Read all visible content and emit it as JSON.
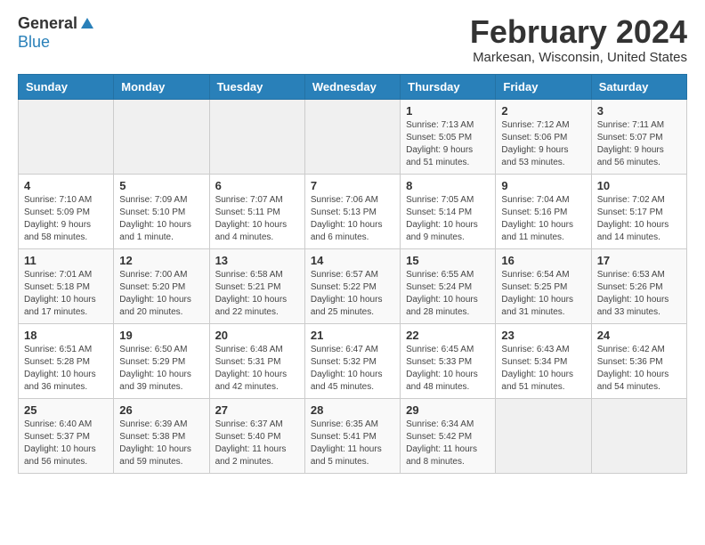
{
  "header": {
    "logo_general": "General",
    "logo_blue": "Blue",
    "month_title": "February 2024",
    "location": "Markesan, Wisconsin, United States"
  },
  "weekdays": [
    "Sunday",
    "Monday",
    "Tuesday",
    "Wednesday",
    "Thursday",
    "Friday",
    "Saturday"
  ],
  "weeks": [
    [
      {
        "day": "",
        "info": ""
      },
      {
        "day": "",
        "info": ""
      },
      {
        "day": "",
        "info": ""
      },
      {
        "day": "",
        "info": ""
      },
      {
        "day": "1",
        "info": "Sunrise: 7:13 AM\nSunset: 5:05 PM\nDaylight: 9 hours\nand 51 minutes."
      },
      {
        "day": "2",
        "info": "Sunrise: 7:12 AM\nSunset: 5:06 PM\nDaylight: 9 hours\nand 53 minutes."
      },
      {
        "day": "3",
        "info": "Sunrise: 7:11 AM\nSunset: 5:07 PM\nDaylight: 9 hours\nand 56 minutes."
      }
    ],
    [
      {
        "day": "4",
        "info": "Sunrise: 7:10 AM\nSunset: 5:09 PM\nDaylight: 9 hours\nand 58 minutes."
      },
      {
        "day": "5",
        "info": "Sunrise: 7:09 AM\nSunset: 5:10 PM\nDaylight: 10 hours\nand 1 minute."
      },
      {
        "day": "6",
        "info": "Sunrise: 7:07 AM\nSunset: 5:11 PM\nDaylight: 10 hours\nand 4 minutes."
      },
      {
        "day": "7",
        "info": "Sunrise: 7:06 AM\nSunset: 5:13 PM\nDaylight: 10 hours\nand 6 minutes."
      },
      {
        "day": "8",
        "info": "Sunrise: 7:05 AM\nSunset: 5:14 PM\nDaylight: 10 hours\nand 9 minutes."
      },
      {
        "day": "9",
        "info": "Sunrise: 7:04 AM\nSunset: 5:16 PM\nDaylight: 10 hours\nand 11 minutes."
      },
      {
        "day": "10",
        "info": "Sunrise: 7:02 AM\nSunset: 5:17 PM\nDaylight: 10 hours\nand 14 minutes."
      }
    ],
    [
      {
        "day": "11",
        "info": "Sunrise: 7:01 AM\nSunset: 5:18 PM\nDaylight: 10 hours\nand 17 minutes."
      },
      {
        "day": "12",
        "info": "Sunrise: 7:00 AM\nSunset: 5:20 PM\nDaylight: 10 hours\nand 20 minutes."
      },
      {
        "day": "13",
        "info": "Sunrise: 6:58 AM\nSunset: 5:21 PM\nDaylight: 10 hours\nand 22 minutes."
      },
      {
        "day": "14",
        "info": "Sunrise: 6:57 AM\nSunset: 5:22 PM\nDaylight: 10 hours\nand 25 minutes."
      },
      {
        "day": "15",
        "info": "Sunrise: 6:55 AM\nSunset: 5:24 PM\nDaylight: 10 hours\nand 28 minutes."
      },
      {
        "day": "16",
        "info": "Sunrise: 6:54 AM\nSunset: 5:25 PM\nDaylight: 10 hours\nand 31 minutes."
      },
      {
        "day": "17",
        "info": "Sunrise: 6:53 AM\nSunset: 5:26 PM\nDaylight: 10 hours\nand 33 minutes."
      }
    ],
    [
      {
        "day": "18",
        "info": "Sunrise: 6:51 AM\nSunset: 5:28 PM\nDaylight: 10 hours\nand 36 minutes."
      },
      {
        "day": "19",
        "info": "Sunrise: 6:50 AM\nSunset: 5:29 PM\nDaylight: 10 hours\nand 39 minutes."
      },
      {
        "day": "20",
        "info": "Sunrise: 6:48 AM\nSunset: 5:31 PM\nDaylight: 10 hours\nand 42 minutes."
      },
      {
        "day": "21",
        "info": "Sunrise: 6:47 AM\nSunset: 5:32 PM\nDaylight: 10 hours\nand 45 minutes."
      },
      {
        "day": "22",
        "info": "Sunrise: 6:45 AM\nSunset: 5:33 PM\nDaylight: 10 hours\nand 48 minutes."
      },
      {
        "day": "23",
        "info": "Sunrise: 6:43 AM\nSunset: 5:34 PM\nDaylight: 10 hours\nand 51 minutes."
      },
      {
        "day": "24",
        "info": "Sunrise: 6:42 AM\nSunset: 5:36 PM\nDaylight: 10 hours\nand 54 minutes."
      }
    ],
    [
      {
        "day": "25",
        "info": "Sunrise: 6:40 AM\nSunset: 5:37 PM\nDaylight: 10 hours\nand 56 minutes."
      },
      {
        "day": "26",
        "info": "Sunrise: 6:39 AM\nSunset: 5:38 PM\nDaylight: 10 hours\nand 59 minutes."
      },
      {
        "day": "27",
        "info": "Sunrise: 6:37 AM\nSunset: 5:40 PM\nDaylight: 11 hours\nand 2 minutes."
      },
      {
        "day": "28",
        "info": "Sunrise: 6:35 AM\nSunset: 5:41 PM\nDaylight: 11 hours\nand 5 minutes."
      },
      {
        "day": "29",
        "info": "Sunrise: 6:34 AM\nSunset: 5:42 PM\nDaylight: 11 hours\nand 8 minutes."
      },
      {
        "day": "",
        "info": ""
      },
      {
        "day": "",
        "info": ""
      }
    ]
  ]
}
